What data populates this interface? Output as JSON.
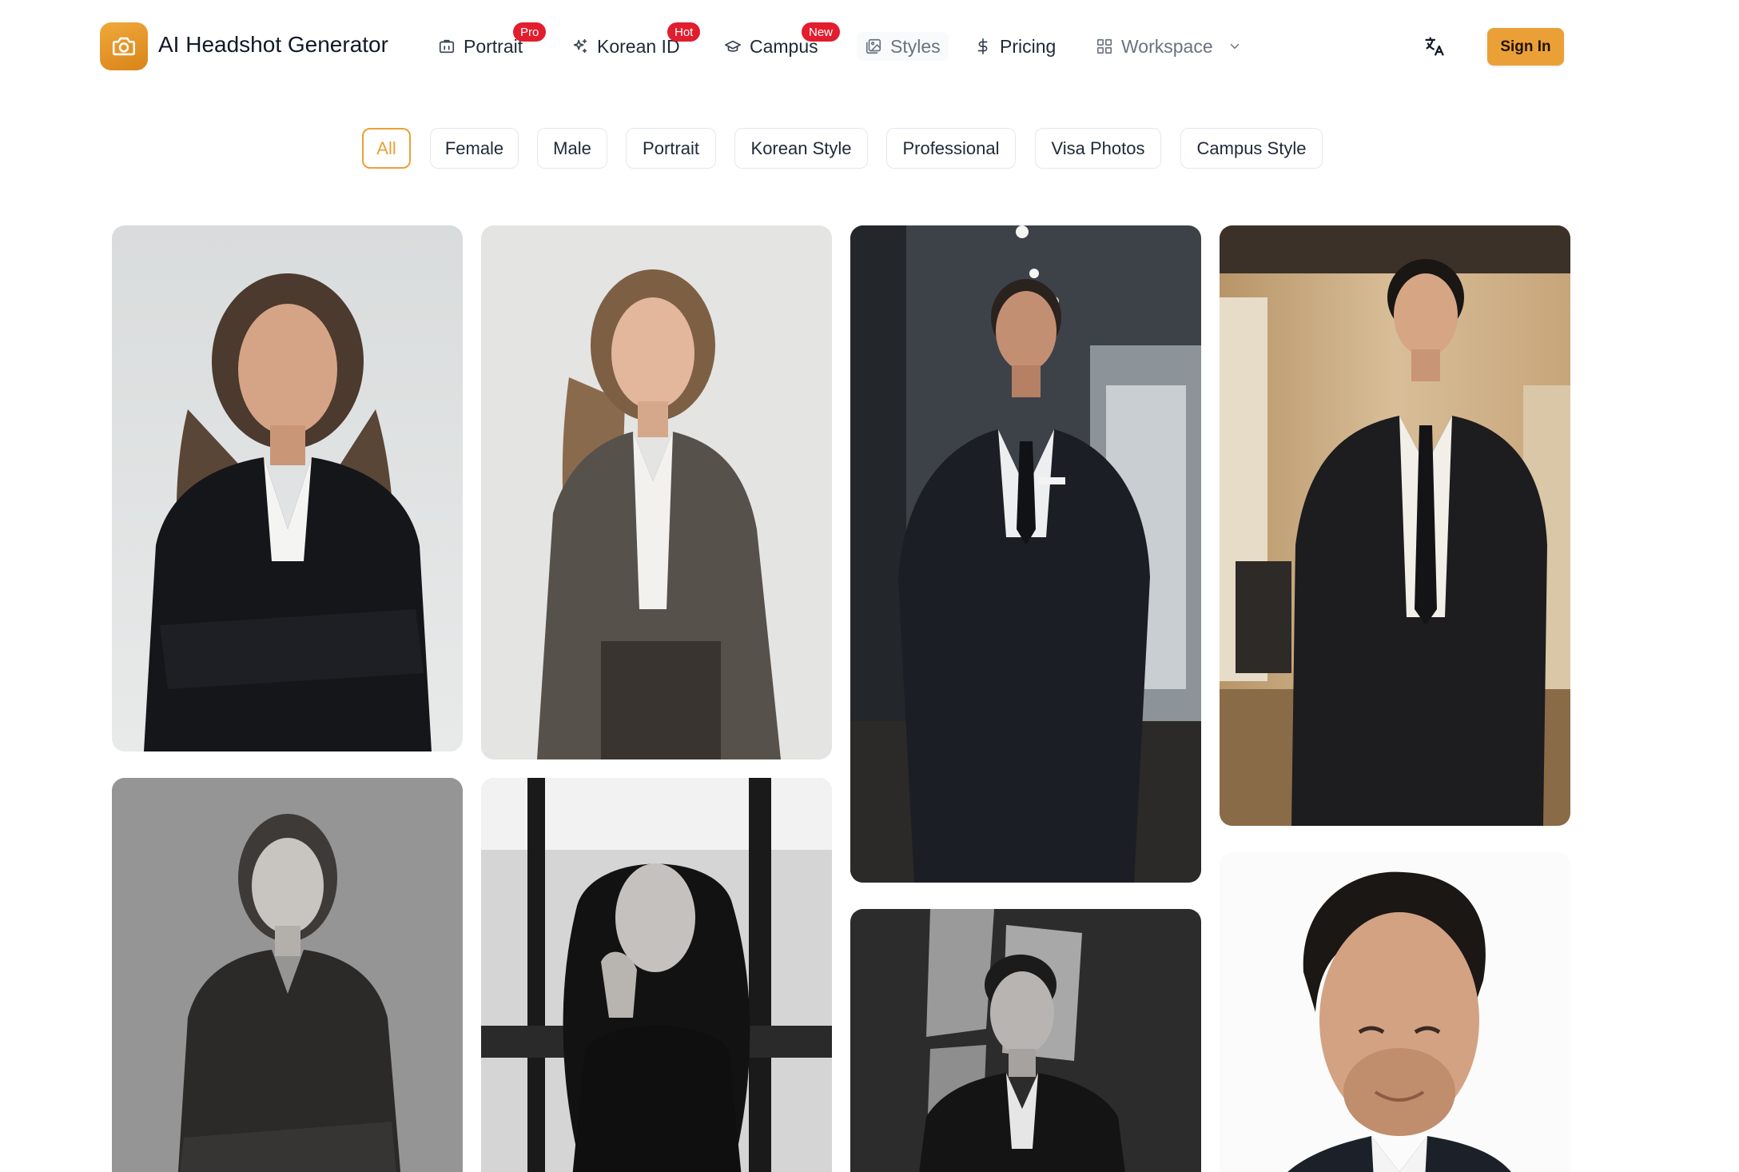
{
  "brand": {
    "title": "AI Headshot Generator",
    "logo_icon": "camera-icon",
    "accent": "#eba037"
  },
  "nav": {
    "items": [
      {
        "label": "Portrait",
        "icon": "id-card-icon",
        "badge": "Pro"
      },
      {
        "label": "Korean ID",
        "icon": "sparkles-icon",
        "badge": "Hot"
      },
      {
        "label": "Campus",
        "icon": "graduation-cap-icon",
        "badge": "New"
      },
      {
        "label": "Styles",
        "icon": "images-icon"
      },
      {
        "label": "Pricing",
        "icon": "dollar-icon"
      },
      {
        "label": "Workspace",
        "icon": "grid-icon"
      }
    ],
    "badge_color": "#e11d2e",
    "translate_icon": "translate-icon",
    "sign_in": "Sign In"
  },
  "filters": {
    "selected": "All",
    "items": [
      "All",
      "Female",
      "Male",
      "Portrait",
      "Korean Style",
      "Professional",
      "Visa Photos",
      "Campus Style"
    ]
  },
  "gallery": {
    "photos": [
      "woman-dark-suit-arms-crossed",
      "woman-grey-blazer-standing",
      "man-black-suit-office-hallway",
      "asian-man-black-suit-office",
      "woman-bw-portrait-seated",
      "woman-bw-hand-on-chin",
      "man-bw-suit-shadows",
      "man-headshot-white-background"
    ]
  }
}
